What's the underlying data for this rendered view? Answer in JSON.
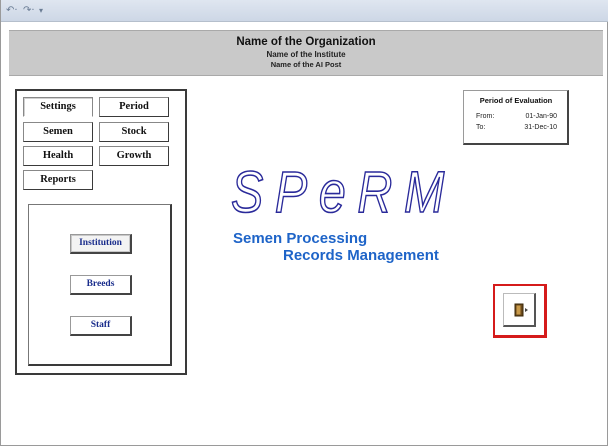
{
  "toolbar": {
    "undo_icon": "undo-icon",
    "redo_icon": "redo-icon",
    "customize_icon": "customize-qat-icon"
  },
  "header": {
    "organization": "Name of the Organization",
    "institute": "Name of the Institute",
    "post": "Name of the AI Post"
  },
  "nav": {
    "tabs": [
      {
        "label": "Settings"
      },
      {
        "label": "Period"
      },
      {
        "label": "Semen"
      },
      {
        "label": "Stock"
      },
      {
        "label": "Health"
      },
      {
        "label": "Growth"
      },
      {
        "label": "Reports"
      }
    ],
    "active_tab": "Settings",
    "subbuttons": [
      {
        "label": "Institution"
      },
      {
        "label": "Breeds"
      },
      {
        "label": "Staff"
      }
    ]
  },
  "period": {
    "title": "Period of Evaluation",
    "from_label": "From:",
    "from_value": "01-Jan-90",
    "to_label": "To:",
    "to_value": "31-Dec-10"
  },
  "logo": {
    "text": "SPeRM",
    "tagline_line1": "Semen Processing",
    "tagline_line2": "Records Management",
    "color": "#1e64c8"
  },
  "exit": {
    "icon": "exit-door-icon",
    "border_color": "#d51b1b"
  }
}
